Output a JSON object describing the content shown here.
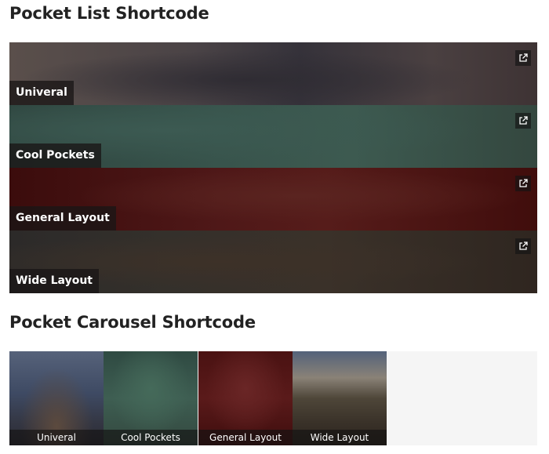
{
  "sections": {
    "list_title": "Pocket List Shortcode",
    "carousel_title": "Pocket Carousel Shortcode"
  },
  "pockets": [
    {
      "label": "Univeral",
      "icon": "external-link-icon"
    },
    {
      "label": "Cool Pockets",
      "icon": "external-link-icon"
    },
    {
      "label": "General Layout",
      "icon": "external-link-icon"
    },
    {
      "label": "Wide Layout",
      "icon": "external-link-icon"
    }
  ],
  "carousel": [
    {
      "label": "Univeral"
    },
    {
      "label": "Cool Pockets"
    },
    {
      "label": "General Layout"
    },
    {
      "label": "Wide Layout"
    }
  ]
}
